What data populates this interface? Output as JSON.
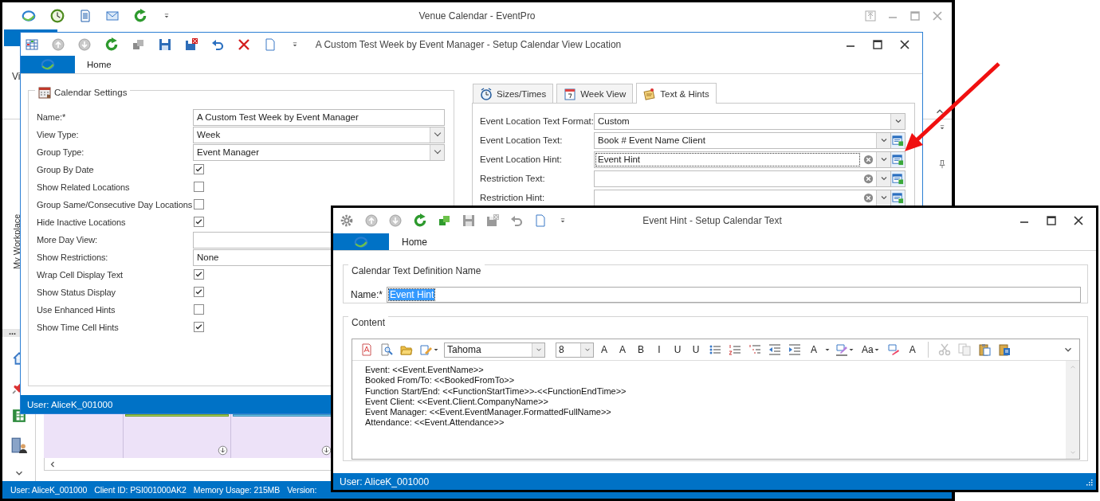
{
  "main_window": {
    "title": "Venue Calendar - EventPro",
    "ribbon_fragment": "Vi",
    "sidebar_title": "My Workplace",
    "sidebar_more": "...",
    "status_bar": [
      "User: AliceK_001000",
      "Client ID: PSI001000AK2",
      "Memory Usage: 215MB",
      "Version:"
    ]
  },
  "setup_window": {
    "title": "A Custom Test Week by Event Manager - Setup Calendar View Location",
    "ribbon_tab": "Home",
    "settings_group": {
      "title": "Calendar Settings",
      "fields": [
        {
          "kind": "text",
          "label": "Name:*",
          "value": "A Custom Test Week by Event Manager"
        },
        {
          "kind": "dropdown",
          "label": "View Type:",
          "value": "Week"
        },
        {
          "kind": "dropdown",
          "label": "Group Type:",
          "value": "Event Manager"
        },
        {
          "kind": "checkbox",
          "label": "Group By Date",
          "checked": true
        },
        {
          "kind": "checkbox",
          "label": "Show Related Locations",
          "checked": false
        },
        {
          "kind": "checkbox",
          "label": "Group Same/Consecutive Day Locations",
          "checked": false
        },
        {
          "kind": "checkbox",
          "label": "Hide Inactive Locations",
          "checked": true
        },
        {
          "kind": "text",
          "label": "More Day View:"
        },
        {
          "kind": "dropdown",
          "label": "Show Restrictions:",
          "value": "None"
        },
        {
          "kind": "checkbox",
          "label": "Wrap Cell Display Text",
          "checked": true
        },
        {
          "kind": "checkbox",
          "label": "Show Status Display",
          "checked": true
        },
        {
          "kind": "checkbox",
          "label": "Use Enhanced Hints",
          "checked": false
        },
        {
          "kind": "checkbox",
          "label": "Show Time Cell Hints",
          "checked": true
        }
      ]
    },
    "tabs": [
      {
        "kind": "clock",
        "label": "Sizes/Times",
        "selected": false
      },
      {
        "kind": "calendar",
        "label": "Week View",
        "selected": false
      },
      {
        "kind": "note",
        "label": "Text & Hints",
        "selected": true
      }
    ],
    "hint_fields": [
      {
        "label": "Event Location Text Format:",
        "value": "Custom",
        "clear": false,
        "editor": false,
        "focused": false
      },
      {
        "label": "Event Location Text:",
        "value": "Book # Event Name Client",
        "clear": false,
        "editor": true,
        "focused": false
      },
      {
        "label": "Event Location Hint:",
        "value": "Event Hint",
        "clear": true,
        "editor": true,
        "focused": true
      },
      {
        "label": "Restriction Text:",
        "clear": true,
        "editor": true,
        "focused": false
      },
      {
        "label": "Restriction Hint:",
        "clear": true,
        "editor": true,
        "focused": false
      }
    ],
    "status_bar": "User: AliceK_001000"
  },
  "text_window": {
    "title": "Event Hint - Setup Calendar Text",
    "ribbon_tab": "Home",
    "name_group": {
      "title": "Calendar Text Definition Name",
      "label": "Name:*",
      "value": "Event Hint",
      "text_selected": true
    },
    "content_group": {
      "title": "Content",
      "toolbar": [
        {
          "kind": "insert-page",
          "disabled": false
        },
        {
          "kind": "find",
          "disabled": false
        },
        {
          "kind": "open",
          "disabled": false
        },
        {
          "kind": "style-menu",
          "disabled": false
        },
        {
          "kind": "font-combo",
          "value": "Tahoma",
          "disabled": false
        },
        {
          "kind": "size-combo",
          "value": "8",
          "disabled": false
        },
        {
          "kind": "grow-font",
          "text": "A",
          "disabled": false
        },
        {
          "kind": "shrink-font",
          "text": "A",
          "disabled": false
        },
        {
          "kind": "bold",
          "text": "B",
          "disabled": false
        },
        {
          "kind": "italic",
          "text": "I",
          "disabled": false
        },
        {
          "kind": "underline",
          "text": "U",
          "disabled": false
        },
        {
          "kind": "double-underline",
          "text": "U",
          "disabled": false
        },
        {
          "kind": "bullets",
          "disabled": false
        },
        {
          "kind": "numbering",
          "disabled": false
        },
        {
          "kind": "multilevel",
          "disabled": false
        },
        {
          "kind": "outdent",
          "disabled": false
        },
        {
          "kind": "indent",
          "disabled": false
        },
        {
          "kind": "font-color",
          "text": "A",
          "disabled": false
        },
        {
          "kind": "highlight",
          "disabled": false
        },
        {
          "kind": "change-case",
          "text": "Aa",
          "disabled": false
        },
        {
          "kind": "spelling",
          "disabled": false
        },
        {
          "kind": "font-dialog",
          "text": "A",
          "disabled": false
        },
        {
          "kind": "cut",
          "disabled": true
        },
        {
          "kind": "copy",
          "disabled": true
        },
        {
          "kind": "paste",
          "disabled": false
        },
        {
          "kind": "paste-special",
          "disabled": false
        },
        {
          "kind": "more",
          "disabled": false
        }
      ],
      "lines": [
        "Event: <<Event.EventName>>",
        "Booked From/To: <<BookedFromTo>>",
        "Function Start/End: <<FunctionStartTime>>-<<FunctionEndTime>>",
        "Event Client: <<Event.Client.CompanyName>>",
        "Event Manager: <<Event.EventManager.FormattedFullName>>",
        "Attendance: <<Event.Attendance>>"
      ]
    },
    "status_bar": "User: AliceK_001000"
  }
}
